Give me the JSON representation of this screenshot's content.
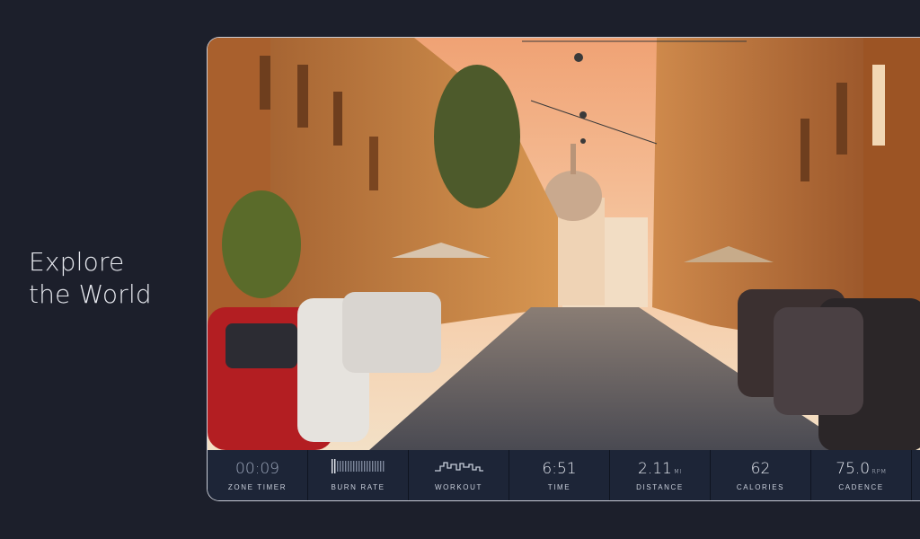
{
  "hero": {
    "line1": "Explore",
    "line2": "the World"
  },
  "stats": [
    {
      "label": "ZONE TIMER",
      "value": "00:09",
      "unit": ""
    },
    {
      "label": "BURN RATE",
      "icon": "burn-rate-meter-icon",
      "level": 0.1
    },
    {
      "label": "WORKOUT",
      "icon": "workout-profile-icon"
    },
    {
      "label": "TIME",
      "value": "6:51",
      "unit": ""
    },
    {
      "label": "DISTANCE",
      "value": "2.11",
      "unit": "MI"
    },
    {
      "label": "CALORIES",
      "value": "62",
      "unit": ""
    },
    {
      "label": "CADENCE",
      "value": "75.0",
      "unit": "RPM"
    }
  ],
  "colors": {
    "background": "#1c1f2b",
    "stat_bar": "#1d2537",
    "text": "#e9ecf3"
  }
}
